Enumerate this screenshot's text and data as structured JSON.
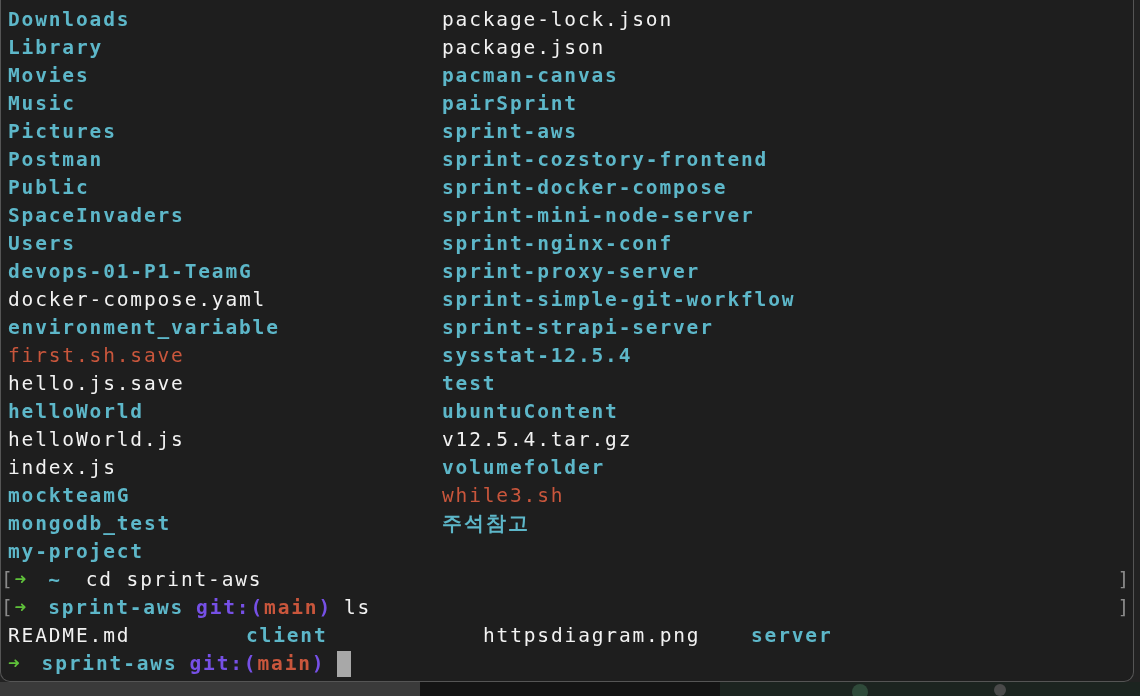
{
  "listing": {
    "columns": [
      [
        {
          "name": "Downloads",
          "kind": "dir"
        },
        {
          "name": "Library",
          "kind": "dir"
        },
        {
          "name": "Movies",
          "kind": "dir"
        },
        {
          "name": "Music",
          "kind": "dir"
        },
        {
          "name": "Pictures",
          "kind": "dir"
        },
        {
          "name": "Postman",
          "kind": "dir"
        },
        {
          "name": "Public",
          "kind": "dir"
        },
        {
          "name": "SpaceInvaders",
          "kind": "dir"
        },
        {
          "name": "Users",
          "kind": "dir"
        },
        {
          "name": "devops-01-P1-TeamG",
          "kind": "dir"
        },
        {
          "name": "docker-compose.yaml",
          "kind": "file"
        },
        {
          "name": "environment_variable",
          "kind": "dir"
        },
        {
          "name": "first.sh.save",
          "kind": "exec"
        },
        {
          "name": "hello.js.save",
          "kind": "file"
        },
        {
          "name": "helloWorld",
          "kind": "dir"
        },
        {
          "name": "helloWorld.js",
          "kind": "file"
        },
        {
          "name": "index.js",
          "kind": "file"
        },
        {
          "name": "mockteamG",
          "kind": "dir"
        },
        {
          "name": "mongodb_test",
          "kind": "dir"
        },
        {
          "name": "my-project",
          "kind": "dir"
        }
      ],
      [
        {
          "name": "package-lock.json",
          "kind": "file"
        },
        {
          "name": "package.json",
          "kind": "file"
        },
        {
          "name": "pacman-canvas",
          "kind": "dir"
        },
        {
          "name": "pairSprint",
          "kind": "dir"
        },
        {
          "name": "sprint-aws",
          "kind": "dir"
        },
        {
          "name": "sprint-cozstory-frontend",
          "kind": "dir"
        },
        {
          "name": "sprint-docker-compose",
          "kind": "dir"
        },
        {
          "name": "sprint-mini-node-server",
          "kind": "dir"
        },
        {
          "name": "sprint-nginx-conf",
          "kind": "dir"
        },
        {
          "name": "sprint-proxy-server",
          "kind": "dir"
        },
        {
          "name": "sprint-simple-git-workflow",
          "kind": "dir"
        },
        {
          "name": "sprint-strapi-server",
          "kind": "dir"
        },
        {
          "name": "sysstat-12.5.4",
          "kind": "dir"
        },
        {
          "name": "test",
          "kind": "dir"
        },
        {
          "name": "ubuntuContent",
          "kind": "dir"
        },
        {
          "name": "v12.5.4.tar.gz",
          "kind": "file"
        },
        {
          "name": "volumefolder",
          "kind": "dir"
        },
        {
          "name": "while3.sh",
          "kind": "exec"
        },
        {
          "name": "주석참고",
          "kind": "dir"
        }
      ]
    ]
  },
  "session": [
    {
      "kind": "prompt",
      "left_mark": "[",
      "arrow": "➜",
      "dir": "~",
      "command": "cd sprint-aws",
      "right_mark": "]",
      "cursor": false
    },
    {
      "kind": "prompt",
      "left_mark": "[",
      "arrow": "➜",
      "dir": "sprint-aws",
      "git_prefix": "git:(",
      "branch": "main",
      "git_suffix": ")",
      "command": "ls",
      "right_mark": "]",
      "cursor": false
    },
    {
      "kind": "output",
      "entries": [
        {
          "name": "README.md",
          "kind": "file"
        },
        {
          "name": "client",
          "kind": "dir"
        },
        {
          "name": "httpsdiagram.png",
          "kind": "file"
        },
        {
          "name": "server",
          "kind": "dir"
        }
      ]
    },
    {
      "kind": "prompt",
      "arrow": "➜",
      "dir": "sprint-aws",
      "git_prefix": "git:(",
      "branch": "main",
      "git_suffix": ")",
      "cursor": true
    }
  ]
}
